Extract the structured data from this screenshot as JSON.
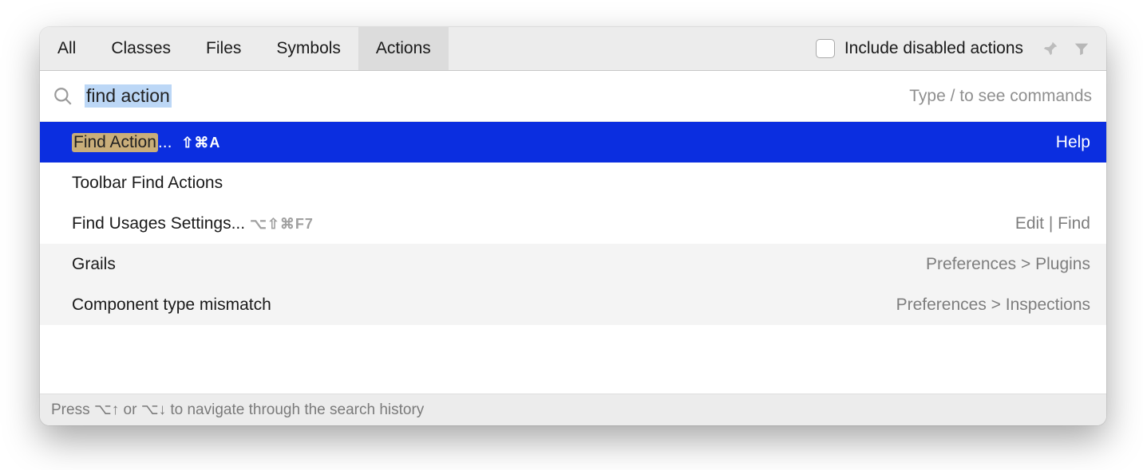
{
  "tabs": [
    {
      "label": "All"
    },
    {
      "label": "Classes"
    },
    {
      "label": "Files"
    },
    {
      "label": "Symbols"
    },
    {
      "label": "Actions"
    }
  ],
  "active_tab_index": 4,
  "include_disabled": {
    "label": "Include disabled actions",
    "checked": false
  },
  "search": {
    "value": "find action",
    "hint": "Type / to see commands"
  },
  "results": [
    {
      "highlight": "Find Action",
      "suffix": "... ",
      "shortcut": "⇧⌘A",
      "location": "Help",
      "selected": true,
      "dim": false
    },
    {
      "label": "Toolbar Find Actions",
      "location": "",
      "selected": false,
      "dim": false
    },
    {
      "label": "Find Usages Settings... ",
      "shortcut": "⌥⇧⌘F7",
      "shortcut_dim": true,
      "location": "Edit | Find",
      "selected": false,
      "dim": false
    },
    {
      "label": "Grails",
      "location": "Preferences > Plugins",
      "selected": false,
      "dim": true
    },
    {
      "label": "Component type mismatch",
      "location": "Preferences > Inspections",
      "selected": false,
      "dim": true
    }
  ],
  "footer": "Press ⌥↑ or ⌥↓ to navigate through the search history"
}
